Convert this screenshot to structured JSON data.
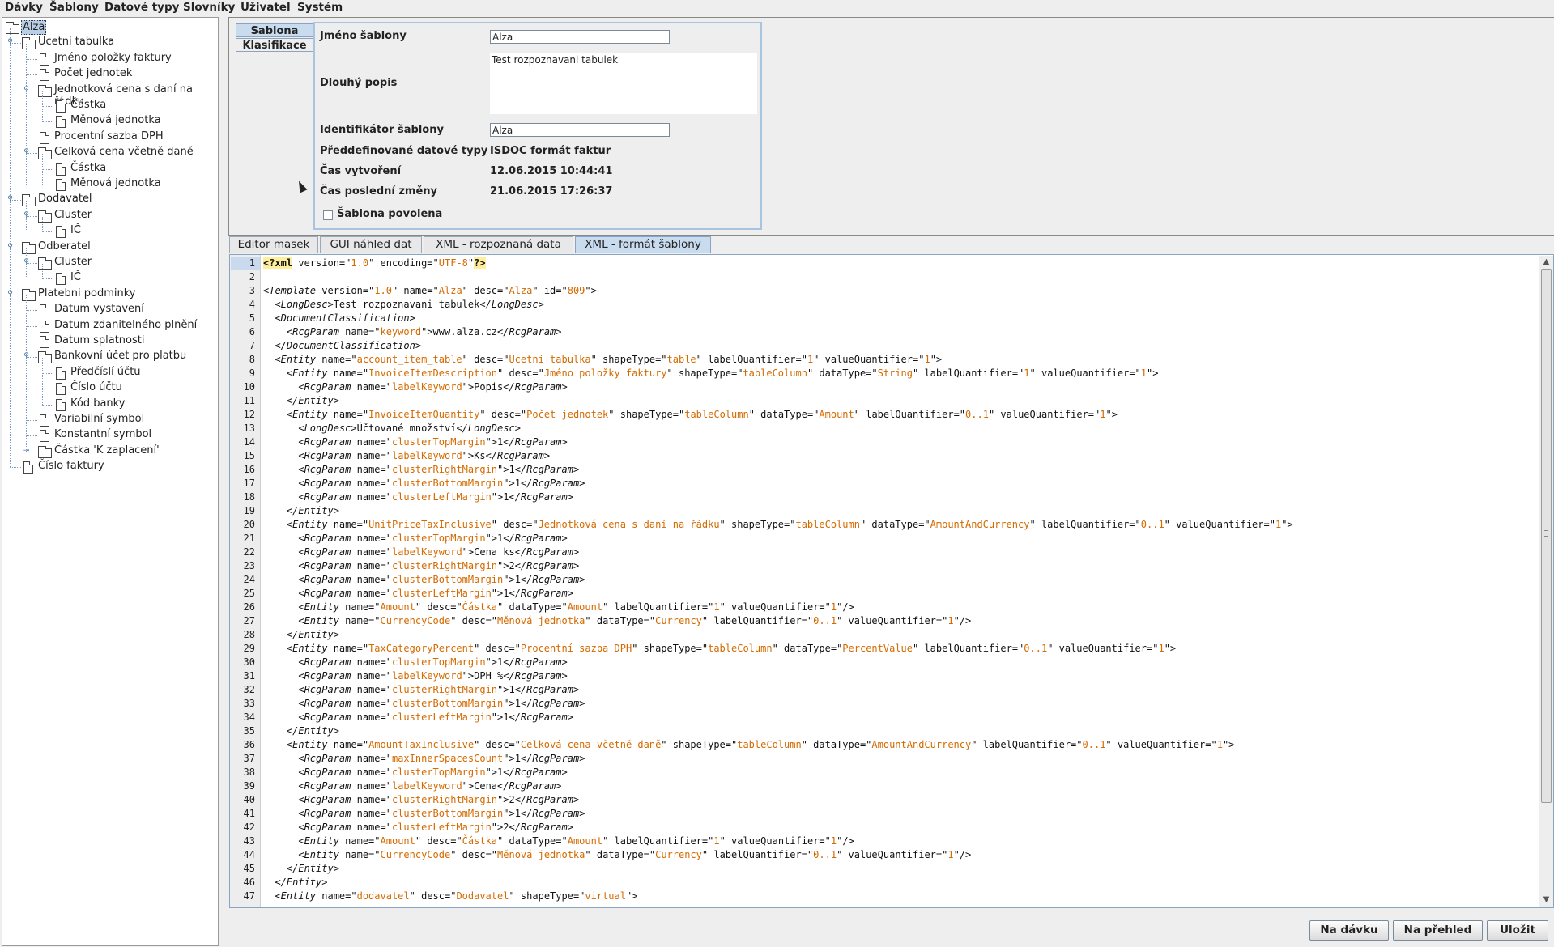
{
  "menu": [
    "Dávky",
    "Šablony",
    "Datové typy",
    "Slovníky",
    "Uživatel",
    "Systém"
  ],
  "tree": [
    {
      "label": "Alza",
      "type": "folder",
      "selected": true
    },
    {
      "label": "Ucetni tabulka",
      "type": "folder"
    },
    {
      "label": "Jméno položky faktury",
      "type": "doc"
    },
    {
      "label": "Počet jednotek",
      "type": "doc"
    },
    {
      "label": "Jednotková cena s daní na řádku",
      "type": "folder"
    },
    {
      "label": "Částka",
      "type": "doc"
    },
    {
      "label": "Měnová jednotka",
      "type": "doc"
    },
    {
      "label": "Procentní sazba DPH",
      "type": "doc"
    },
    {
      "label": "Celková cena včetně daně",
      "type": "folder"
    },
    {
      "label": "Částka",
      "type": "doc"
    },
    {
      "label": "Měnová jednotka",
      "type": "doc"
    },
    {
      "label": "Dodavatel",
      "type": "folder"
    },
    {
      "label": "Cluster",
      "type": "folder"
    },
    {
      "label": "IČ",
      "type": "doc"
    },
    {
      "label": "Odberatel",
      "type": "folder"
    },
    {
      "label": "Cluster",
      "type": "folder"
    },
    {
      "label": "IČ",
      "type": "doc"
    },
    {
      "label": "Platebni podminky",
      "type": "folder"
    },
    {
      "label": "Datum vystavení",
      "type": "doc"
    },
    {
      "label": "Datum zdanitelného plnění",
      "type": "doc"
    },
    {
      "label": "Datum splatnosti",
      "type": "doc"
    },
    {
      "label": "Bankovní účet pro platbu",
      "type": "folder"
    },
    {
      "label": "Předčíslí účtu",
      "type": "doc"
    },
    {
      "label": "Číslo účtu",
      "type": "doc"
    },
    {
      "label": "Kód banky",
      "type": "doc"
    },
    {
      "label": "Variabilní symbol",
      "type": "doc"
    },
    {
      "label": "Konstantní symbol",
      "type": "doc"
    },
    {
      "label": "Částka 'K zaplacení'",
      "type": "folder"
    },
    {
      "label": "Číslo faktury",
      "type": "doc"
    }
  ],
  "side_tabs": [
    "Sablona",
    "Klasifikace"
  ],
  "form": {
    "name_label": "Jméno šablony",
    "name_value": "Alza",
    "desc_label": "Dlouhý popis",
    "desc_value": "Test rozpoznavani tabulek",
    "id_label": "Identifikátor šablony",
    "id_value": "Alza",
    "types_label": "Předdefinované datové typy",
    "types_value": "ISDOC formát faktur",
    "created_label": "Čas vytvoření",
    "created_value": "12.06.2015 10:44:41",
    "modified_label": "Čas poslední změny",
    "modified_value": "21.06.2015 17:26:37",
    "enabled_label": "Šablona povolena"
  },
  "tabs": [
    "Editor masek",
    "GUI náhled dat",
    "XML - rozpoznaná data",
    "XML - formát šablony"
  ],
  "active_tab": 3,
  "code_lines": [
    "<?xml version=\"1.0\" encoding=\"UTF-8\"?>",
    "",
    "<Template version=\"1.0\" name=\"Alza\" desc=\"Alza\" id=\"809\">",
    "  <LongDesc>Test rozpoznavani tabulek</LongDesc>",
    "  <DocumentClassification>",
    "    <RcgParam name=\"keyword\">www.alza.cz</RcgParam>",
    "  </DocumentClassification>",
    "  <Entity name=\"account_item_table\" desc=\"Ucetni tabulka\" shapeType=\"table\" labelQuantifier=\"1\" valueQuantifier=\"1\">",
    "    <Entity name=\"InvoiceItemDescription\" desc=\"Jméno položky faktury\" shapeType=\"tableColumn\" dataType=\"String\" labelQuantifier=\"1\" valueQuantifier=\"1\">",
    "      <RcgParam name=\"labelKeyword\">Popis</RcgParam>",
    "    </Entity>",
    "    <Entity name=\"InvoiceItemQuantity\" desc=\"Počet jednotek\" shapeType=\"tableColumn\" dataType=\"Amount\" labelQuantifier=\"0..1\" valueQuantifier=\"1\">",
    "      <LongDesc>Účtované množství</LongDesc>",
    "      <RcgParam name=\"clusterTopMargin\">1</RcgParam>",
    "      <RcgParam name=\"labelKeyword\">Ks</RcgParam>",
    "      <RcgParam name=\"clusterRightMargin\">1</RcgParam>",
    "      <RcgParam name=\"clusterBottomMargin\">1</RcgParam>",
    "      <RcgParam name=\"clusterLeftMargin\">1</RcgParam>",
    "    </Entity>",
    "    <Entity name=\"UnitPriceTaxInclusive\" desc=\"Jednotková cena s daní na řádku\" shapeType=\"tableColumn\" dataType=\"AmountAndCurrency\" labelQuantifier=\"0..1\" valueQuantifier=\"1\">",
    "      <RcgParam name=\"clusterTopMargin\">1</RcgParam>",
    "      <RcgParam name=\"labelKeyword\">Cena ks</RcgParam>",
    "      <RcgParam name=\"clusterRightMargin\">2</RcgParam>",
    "      <RcgParam name=\"clusterBottomMargin\">1</RcgParam>",
    "      <RcgParam name=\"clusterLeftMargin\">1</RcgParam>",
    "      <Entity name=\"Amount\" desc=\"Částka\" dataType=\"Amount\" labelQuantifier=\"1\" valueQuantifier=\"1\"/>",
    "      <Entity name=\"CurrencyCode\" desc=\"Měnová jednotka\" dataType=\"Currency\" labelQuantifier=\"0..1\" valueQuantifier=\"1\"/>",
    "    </Entity>",
    "    <Entity name=\"TaxCategoryPercent\" desc=\"Procentní sazba DPH\" shapeType=\"tableColumn\" dataType=\"PercentValue\" labelQuantifier=\"0..1\" valueQuantifier=\"1\">",
    "      <RcgParam name=\"clusterTopMargin\">1</RcgParam>",
    "      <RcgParam name=\"labelKeyword\">DPH %</RcgParam>",
    "      <RcgParam name=\"clusterRightMargin\">1</RcgParam>",
    "      <RcgParam name=\"clusterBottomMargin\">1</RcgParam>",
    "      <RcgParam name=\"clusterLeftMargin\">1</RcgParam>",
    "    </Entity>",
    "    <Entity name=\"AmountTaxInclusive\" desc=\"Celková cena včetně daně\" shapeType=\"tableColumn\" dataType=\"AmountAndCurrency\" labelQuantifier=\"0..1\" valueQuantifier=\"1\">",
    "      <RcgParam name=\"maxInnerSpacesCount\">1</RcgParam>",
    "      <RcgParam name=\"clusterTopMargin\">1</RcgParam>",
    "      <RcgParam name=\"labelKeyword\">Cena</RcgParam>",
    "      <RcgParam name=\"clusterRightMargin\">2</RcgParam>",
    "      <RcgParam name=\"clusterBottomMargin\">1</RcgParam>",
    "      <RcgParam name=\"clusterLeftMargin\">2</RcgParam>",
    "      <Entity name=\"Amount\" desc=\"Částka\" dataType=\"Amount\" labelQuantifier=\"1\" valueQuantifier=\"1\"/>",
    "      <Entity name=\"CurrencyCode\" desc=\"Měnová jednotka\" dataType=\"Currency\" labelQuantifier=\"0..1\" valueQuantifier=\"1\"/>",
    "    </Entity>",
    "  </Entity>",
    "  <Entity name=\"dodavatel\" desc=\"Dodavatel\" shapeType=\"virtual\">"
  ],
  "buttons": {
    "to_batch": "Na dávku",
    "to_overview": "Na přehled",
    "save": "Uložit"
  },
  "colors": {
    "xml_value": "#d46a00",
    "selection": "#b8cfe5",
    "active_tab": "#c9dcef"
  }
}
